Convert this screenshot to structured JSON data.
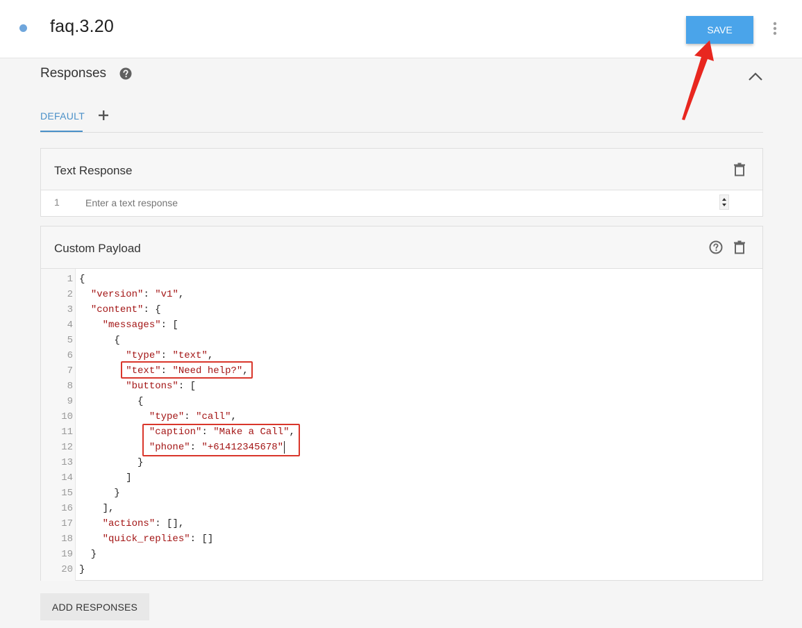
{
  "header": {
    "intent_name": "faq.3.20",
    "save_label": "SAVE"
  },
  "responses": {
    "title": "Responses",
    "tabs": [
      {
        "label": "DEFAULT"
      }
    ]
  },
  "text_response": {
    "title": "Text Response",
    "line_number": "1",
    "placeholder": "Enter a text response"
  },
  "custom_payload": {
    "title": "Custom Payload",
    "lines": [
      {
        "n": "1",
        "code": "{"
      },
      {
        "n": "2",
        "code": "  \"version\": \"v1\","
      },
      {
        "n": "3",
        "code": "  \"content\": {"
      },
      {
        "n": "4",
        "code": "    \"messages\": ["
      },
      {
        "n": "5",
        "code": "      {"
      },
      {
        "n": "6",
        "code": "        \"type\": \"text\","
      },
      {
        "n": "7",
        "code": "        \"text\": \"Need help?\","
      },
      {
        "n": "8",
        "code": "        \"buttons\": ["
      },
      {
        "n": "9",
        "code": "          {"
      },
      {
        "n": "10",
        "code": "            \"type\": \"call\","
      },
      {
        "n": "11",
        "code": "            \"caption\": \"Make a Call\","
      },
      {
        "n": "12",
        "code": "            \"phone\": \"+61412345678\""
      },
      {
        "n": "13",
        "code": "          }"
      },
      {
        "n": "14",
        "code": "        ]"
      },
      {
        "n": "15",
        "code": "      }"
      },
      {
        "n": "16",
        "code": "    ],"
      },
      {
        "n": "17",
        "code": "    \"actions\": [],"
      },
      {
        "n": "18",
        "code": "    \"quick_replies\": []"
      },
      {
        "n": "19",
        "code": "  }"
      },
      {
        "n": "20",
        "code": "}"
      }
    ]
  },
  "footer": {
    "add_responses_label": "ADD RESPONSES"
  },
  "colors": {
    "save_button": "#4aa4ea",
    "tab_active": "#4a90c8",
    "annotation": "#e8271f",
    "highlight_box": "#d9362b",
    "string_token": "#a31515"
  }
}
